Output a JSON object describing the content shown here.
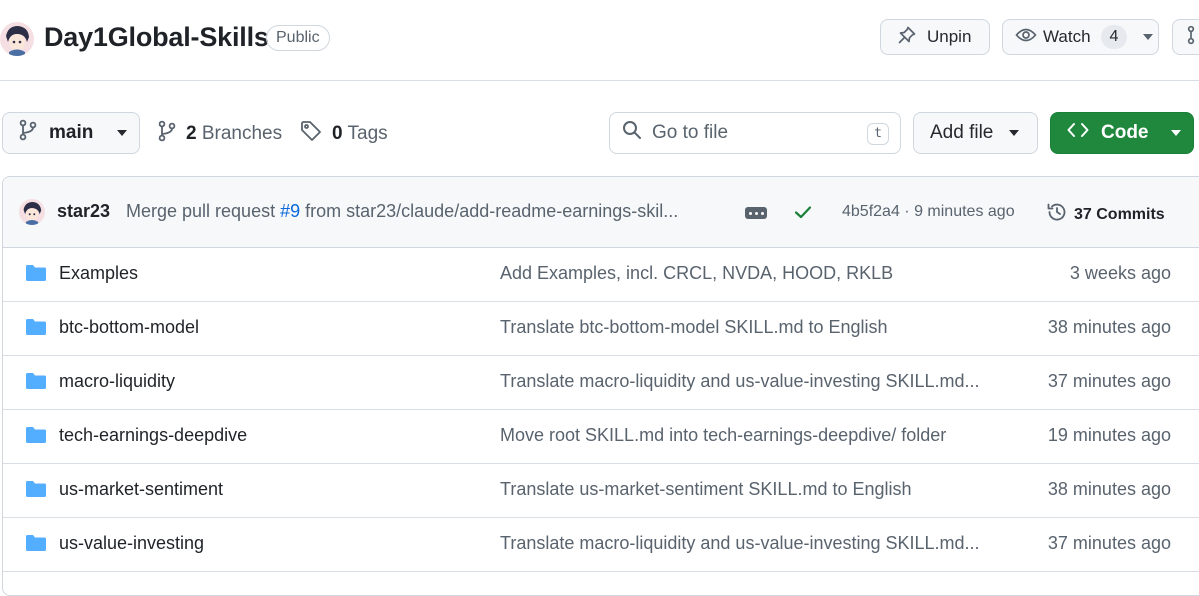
{
  "repo": {
    "name": "Day1Global-Skills",
    "visibility": "Public"
  },
  "actions": {
    "unpin_label": "Unpin",
    "watch_label": "Watch",
    "watch_count": "4"
  },
  "toolbar": {
    "branch": "main",
    "branches_count": "2",
    "branches_label": "Branches",
    "tags_count": "0",
    "tags_label": "Tags",
    "search_placeholder": "Go to file",
    "search_shortcut": "t",
    "add_file_label": "Add file",
    "code_label": "Code"
  },
  "latest_commit": {
    "author": "star23",
    "message_prefix": "Merge pull request ",
    "pr_link": "#9",
    "message_suffix": " from star23/claude/add-readme-earnings-skil...",
    "sha": "4b5f2a4",
    "separator": "·",
    "time": "9 minutes ago",
    "commits_label": "37 Commits"
  },
  "files": [
    {
      "name": "Examples",
      "message": "Add Examples, incl. CRCL, NVDA, HOOD, RKLB",
      "age": "3 weeks ago"
    },
    {
      "name": "btc-bottom-model",
      "message": "Translate btc-bottom-model SKILL.md to English",
      "age": "38 minutes ago"
    },
    {
      "name": "macro-liquidity",
      "message": "Translate macro-liquidity and us-value-investing SKILL.md...",
      "age": "37 minutes ago"
    },
    {
      "name": "tech-earnings-deepdive",
      "message": "Move root SKILL.md into tech-earnings-deepdive/ folder",
      "age": "19 minutes ago"
    },
    {
      "name": "us-market-sentiment",
      "message": "Translate us-market-sentiment SKILL.md to English",
      "age": "38 minutes ago"
    },
    {
      "name": "us-value-investing",
      "message": "Translate macro-liquidity and us-value-investing SKILL.md...",
      "age": "37 minutes ago"
    }
  ],
  "colors": {
    "accent_green": "#1f883d",
    "link_blue": "#0969da",
    "folder_blue": "#54aeff",
    "muted_text": "#59636e"
  }
}
